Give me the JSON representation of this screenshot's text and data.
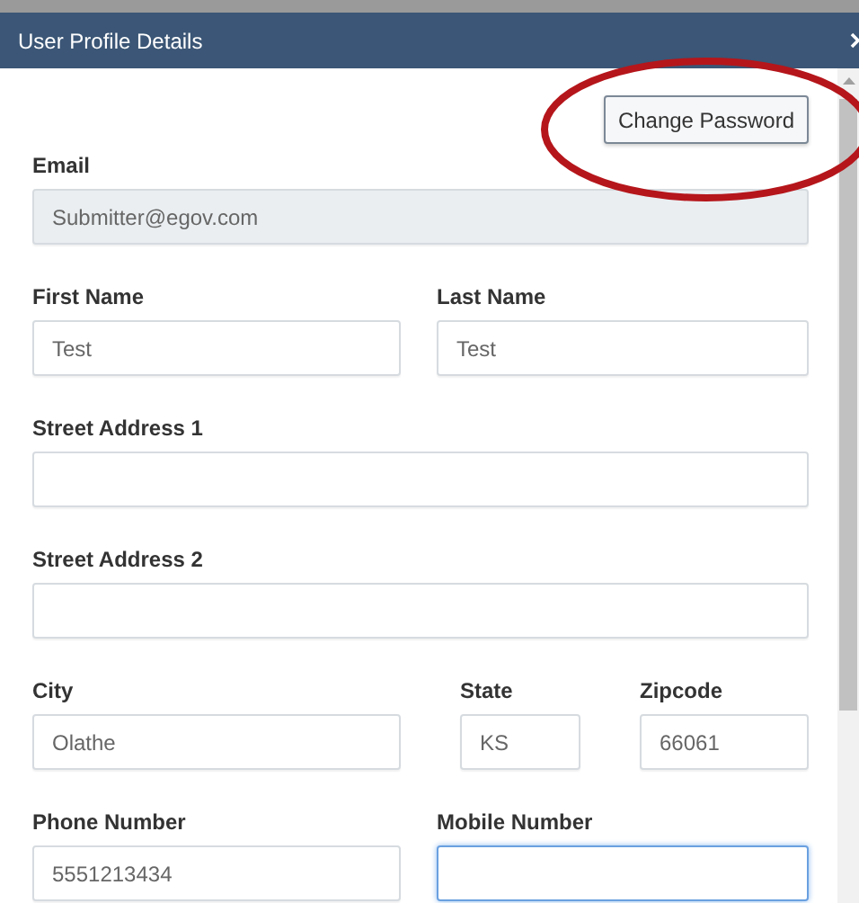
{
  "window": {
    "title": "User Profile Details"
  },
  "change_password_button": "Change Password",
  "form_rows": [
    {
      "fields": [
        {
          "label": "Email",
          "value": "Submitter@egov.com",
          "disabled": true,
          "focused": false
        }
      ]
    },
    {
      "fields": [
        {
          "label": "First Name",
          "value": "Test",
          "disabled": false,
          "focused": false
        },
        {
          "label": "Last Name",
          "value": "Test",
          "disabled": false,
          "focused": false
        }
      ]
    },
    {
      "fields": [
        {
          "label": "Street Address 1",
          "disabled": false,
          "focused": false
        }
      ]
    },
    {
      "fields": [
        {
          "label": "Street Address 2",
          "disabled": false,
          "focused": false
        }
      ]
    },
    {
      "fields": [
        {
          "label": "City",
          "value": "Olathe",
          "disabled": false,
          "focused": false
        },
        {
          "label": "State",
          "value": "KS",
          "disabled": false,
          "focused": false
        },
        {
          "label": "Zipcode",
          "value": "66061",
          "disabled": false,
          "focused": false
        }
      ]
    },
    {
      "fields": [
        {
          "label": "Phone Number",
          "value": "5551213434",
          "disabled": false,
          "focused": false
        },
        {
          "label": "Mobile Number",
          "disabled": false,
          "focused": true
        }
      ]
    }
  ]
}
